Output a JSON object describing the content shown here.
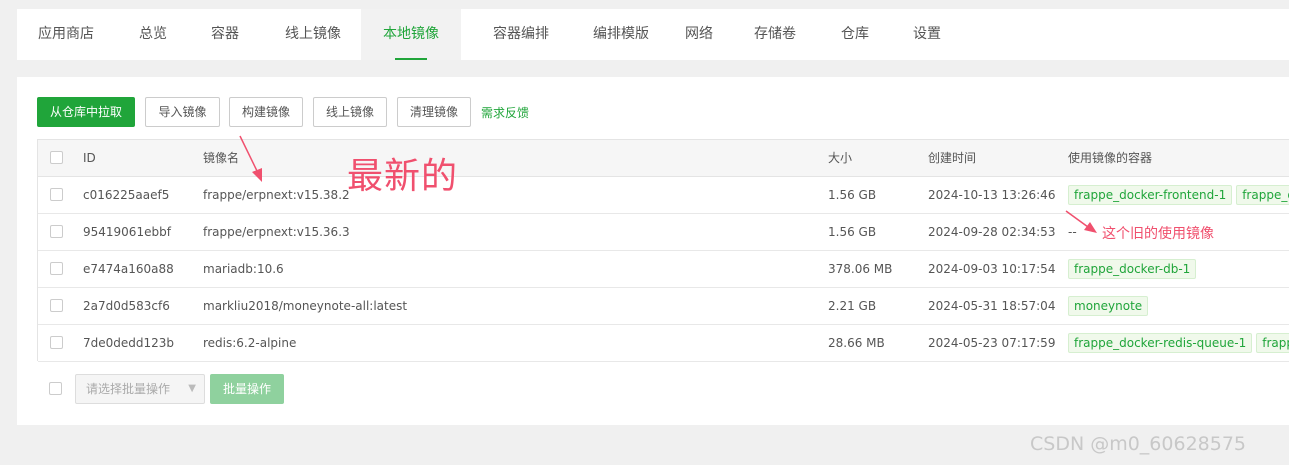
{
  "tabs": [
    {
      "label": "应用商店",
      "active": false
    },
    {
      "label": "总览",
      "active": false
    },
    {
      "label": "容器",
      "active": false
    },
    {
      "label": "线上镜像",
      "active": false
    },
    {
      "label": "本地镜像",
      "active": true
    },
    {
      "label": "容器编排",
      "active": false
    },
    {
      "label": "编排模版",
      "active": false
    },
    {
      "label": "网络",
      "active": false
    },
    {
      "label": "存储卷",
      "active": false
    },
    {
      "label": "仓库",
      "active": false
    },
    {
      "label": "设置",
      "active": false
    }
  ],
  "toolbar": {
    "pull_label": "从仓库中拉取",
    "import_label": "导入镜像",
    "build_label": "构建镜像",
    "online_label": "线上镜像",
    "clean_label": "清理镜像",
    "feedback_label": "需求反馈"
  },
  "table": {
    "headers": {
      "id": "ID",
      "name": "镜像名",
      "size": "大小",
      "created": "创建时间",
      "containers": "使用镜像的容器"
    },
    "rows": [
      {
        "id": "c016225aaef5",
        "name": "frappe/erpnext:v15.38.2",
        "size": "1.56 GB",
        "created": "2024-10-13 13:26:46",
        "containers": [
          "frappe_docker-frontend-1",
          "frappe_do"
        ],
        "empty": ""
      },
      {
        "id": "95419061ebbf",
        "name": "frappe/erpnext:v15.36.3",
        "size": "1.56 GB",
        "created": "2024-09-28 02:34:53",
        "containers": [],
        "empty": "--"
      },
      {
        "id": "e7474a160a88",
        "name": "mariadb:10.6",
        "size": "378.06 MB",
        "created": "2024-09-03 10:17:54",
        "containers": [
          "frappe_docker-db-1"
        ],
        "empty": ""
      },
      {
        "id": "2a7d0d583cf6",
        "name": "markliu2018/moneynote-all:latest",
        "size": "2.21 GB",
        "created": "2024-05-31 18:57:04",
        "containers": [
          "moneynote"
        ],
        "empty": ""
      },
      {
        "id": "7de0dedd123b",
        "name": "redis:6.2-alpine",
        "size": "28.66 MB",
        "created": "2024-05-23 07:17:59",
        "containers": [
          "frappe_docker-redis-queue-1",
          "frappe"
        ],
        "empty": ""
      }
    ]
  },
  "footer": {
    "batch_select_placeholder": "请选择批量操作",
    "batch_button_label": "批量操作"
  },
  "annotations": {
    "newest": "最新的",
    "old_image": "这个旧的使用镜像",
    "color": "#f0506e"
  },
  "watermark": "CSDN @m0_60628575",
  "colors": {
    "accent": "#20a53a",
    "annotation": "#f0506e"
  }
}
